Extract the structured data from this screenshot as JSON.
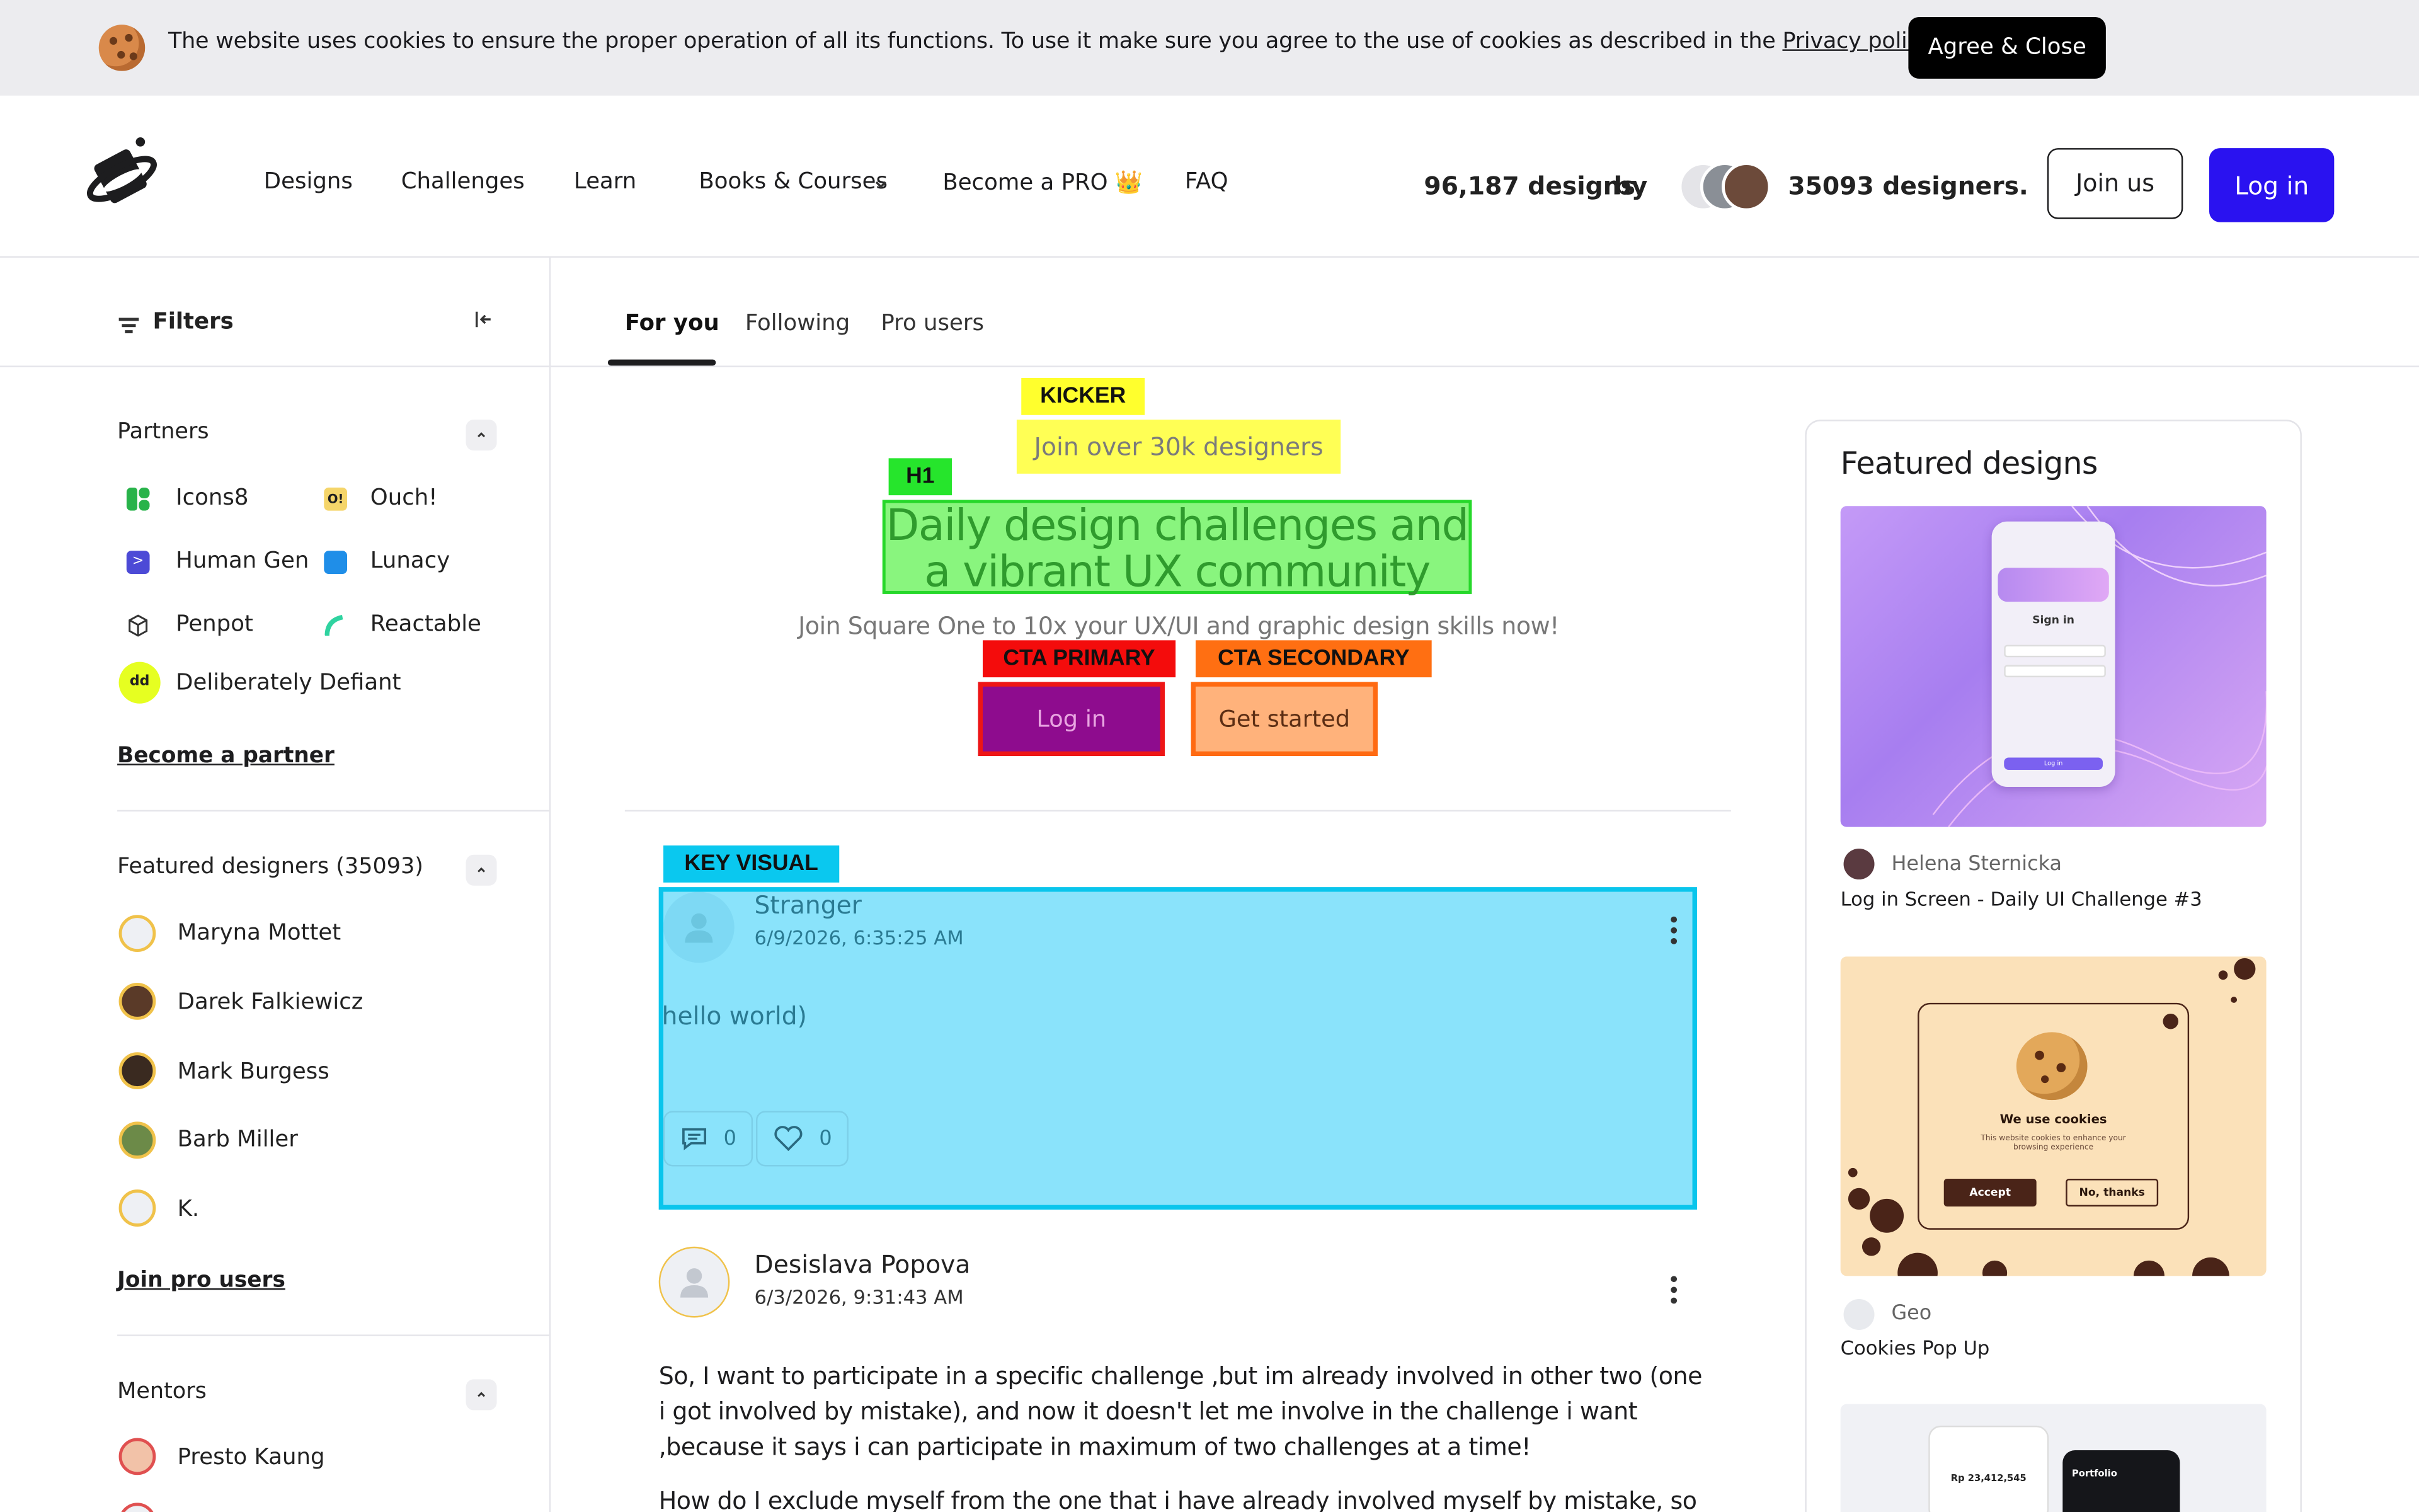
{
  "cookie": {
    "text": "The website uses cookies to ensure the proper operation of all its functions. To use it make sure you agree to the use of cookies as described in the ",
    "link": "Privacy policy",
    "period": ".",
    "button": "Agree & Close"
  },
  "nav": {
    "designs": "Designs",
    "challenges": "Challenges",
    "learn": "Learn",
    "books": "Books & Courses",
    "pro": "Become a PRO 👑",
    "faq": "FAQ"
  },
  "stats": {
    "designs": "96,187 designs",
    "by": "by",
    "designers": "35093 designers."
  },
  "header_buttons": {
    "join": "Join us",
    "login": "Log in"
  },
  "sidebar": {
    "filters": "Filters",
    "partners_title": "Partners",
    "partners": [
      {
        "label": "Icons8"
      },
      {
        "label": "Ouch!"
      },
      {
        "label": "Human Gen"
      },
      {
        "label": "Lunacy"
      },
      {
        "label": "Penpot"
      },
      {
        "label": "Reactable"
      },
      {
        "label": "Deliberately Defiant"
      }
    ],
    "become_partner": "Become a partner",
    "featured_designers_title": "Featured designers",
    "featured_designers_count": "(35093)",
    "designers": [
      "Maryna Mottet",
      "Darek Falkiewicz",
      "Mark Burgess",
      "Barb Miller",
      "K."
    ],
    "join_pro": "Join pro users",
    "mentors_title": "Mentors",
    "mentors": [
      "Presto Kaung"
    ]
  },
  "tabs": [
    "For you",
    "Following",
    "Pro users"
  ],
  "hero": {
    "kicker_tag": "KICKER",
    "kicker": "Join over 30k designers",
    "h1_tag": "H1",
    "h1_line1": "Daily design challenges and",
    "h1_line2": "a vibrant UX community",
    "subline": "Join Square One to 10x your UX/UI and graphic design skills now!",
    "cta_primary_tag": "CTA PRIMARY",
    "cta_secondary_tag": "CTA SECONDARY",
    "cta_primary": "Log in",
    "cta_secondary": "Get started"
  },
  "posts": [
    {
      "tag": "KEY VISUAL",
      "name": "Stranger",
      "date": "6/9/2026, 6:35:25 AM",
      "body": "hello world)",
      "comments": "0",
      "likes": "0"
    },
    {
      "name": "Desislava Popova",
      "date": "6/3/2026, 9:31:43 AM",
      "body": "So, I want to participate in a specific challenge ,but im already involved in other two (one i got involved by mistake), and now it doesn't let me involve in the challenge i want ,because it says i can participate in maximum of two challenges at a time!",
      "body2": "How do I exclude myself from the one that i have already involved myself by mistake, so"
    }
  ],
  "featured": {
    "title": "Featured designs",
    "items": [
      {
        "author": "Helena Sternicka",
        "title": "Log in Screen - Daily UI Challenge #3",
        "mock_signin": "Sign in",
        "mock_login": "Log in"
      },
      {
        "author": "Geo",
        "title": "Cookies Pop Up",
        "mock_title": "We use cookies",
        "mock_text1": "This website cookies to enhance your",
        "mock_text2": "browsing experience",
        "mock_accept": "Accept",
        "mock_decline": "No, thanks"
      },
      {
        "mock_balance": "Rp 23,412,545",
        "mock_portfolio": "Portfolio"
      }
    ]
  },
  "colors": {
    "accent": "#2a12f0",
    "kicker": "#ffff55",
    "h1": "#89f57e",
    "cta_primary": "#8e0c8e",
    "cta_secondary": "#ffb27b",
    "key_visual": "#8ae3fb"
  }
}
